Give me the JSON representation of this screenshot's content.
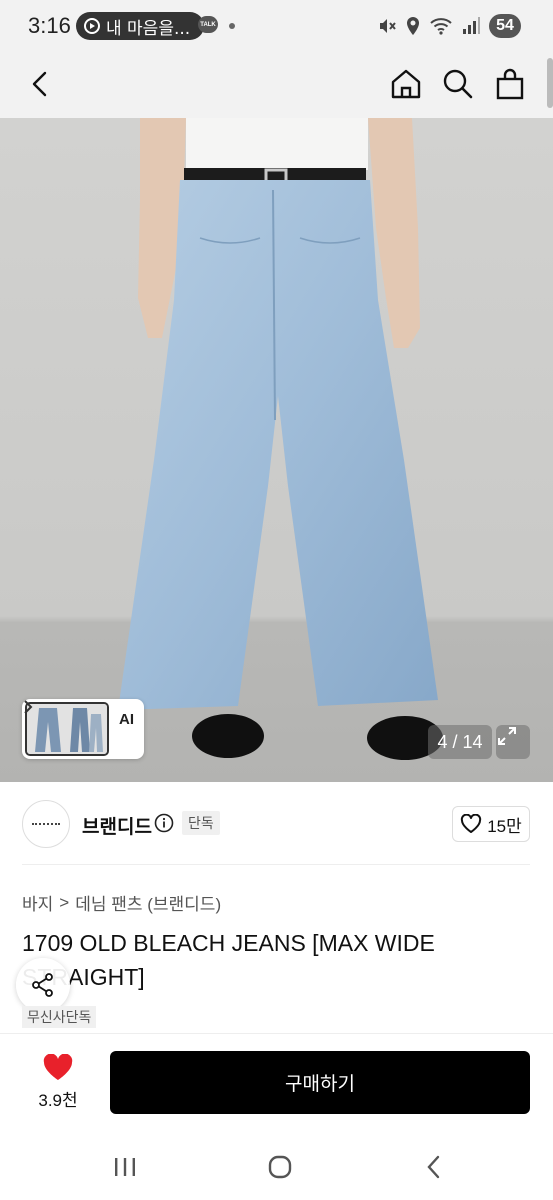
{
  "status_bar": {
    "time": "3:16",
    "notification_pill": "내 마음을...",
    "talk_icon": "TALK",
    "battery": "54",
    "icons": [
      "mute-icon",
      "location-icon",
      "wifi-icon",
      "signal-icon"
    ]
  },
  "nav": {
    "icons": [
      "back-arrow-icon",
      "home-icon",
      "search-icon",
      "shopping-bag-icon"
    ]
  },
  "gallery": {
    "ai_label": "AI",
    "counter": "4 / 14",
    "current_index": 4,
    "total": 14
  },
  "brand": {
    "name": "브랜디드",
    "exclusive_tag": "단독",
    "likes": "15만"
  },
  "product": {
    "breadcrumb": [
      "바지",
      "데님 팬츠 (브랜디드)"
    ],
    "breadcrumb_separator": ">",
    "title": "1709 OLD BLEACH JEANS [MAX WIDE STRAIGHT]",
    "store_tag": "무신사단독"
  },
  "bottom_bar": {
    "heart_count": "3.9천",
    "buy_label": "구매하기"
  },
  "colors": {
    "accent_heart": "#e8212b",
    "buy_button": "#000000",
    "status_bar_bg": "#f2f2f2"
  }
}
